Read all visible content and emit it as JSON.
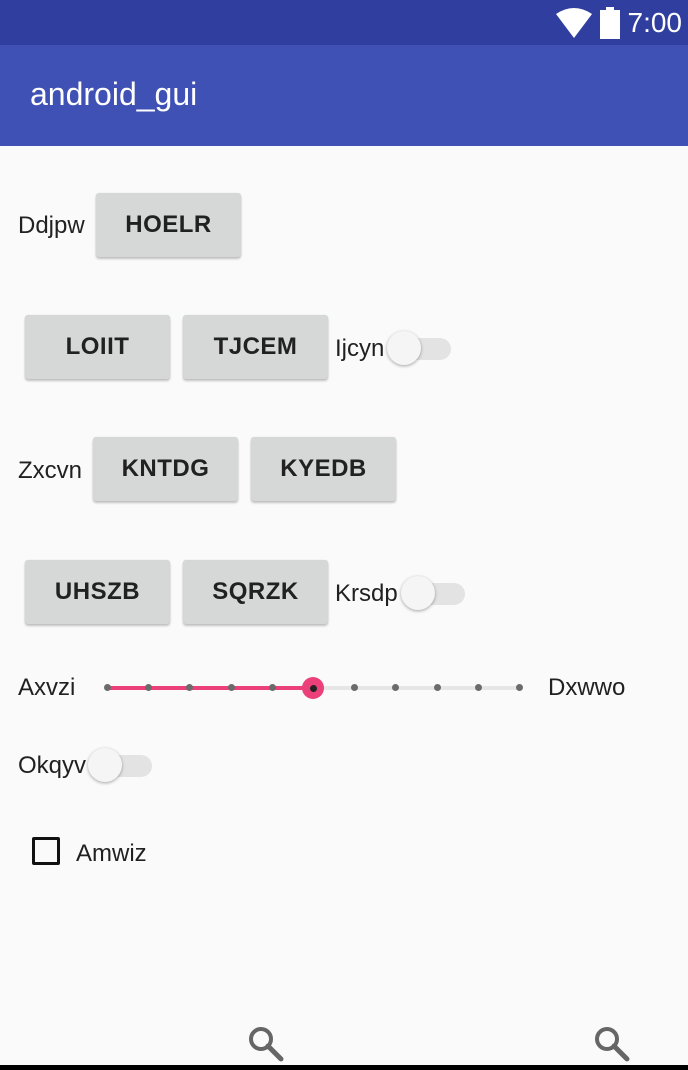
{
  "status_bar": {
    "time": "7:00",
    "icons": [
      "wifi-icon",
      "battery-icon"
    ],
    "color": "#303f9f"
  },
  "app_bar": {
    "title": "android_gui",
    "color": "#3f51b5"
  },
  "rows": {
    "row1": {
      "label": "Ddjpw",
      "button": "HOELR"
    },
    "row2": {
      "buttons": [
        "LOIIT",
        "TJCEM"
      ],
      "switch_label": "Ijcyn",
      "switch_on": false
    },
    "row3": {
      "label": "Zxcvn",
      "buttons": [
        "KNTDG",
        "KYEDB"
      ]
    },
    "row4": {
      "buttons": [
        "UHSZB",
        "SQRZK"
      ],
      "switch_label": "Krsdp",
      "switch_on": false
    },
    "slider": {
      "min_label": "Axvzi",
      "max_label": "Dxwwo",
      "steps": 10,
      "value": 5,
      "accent": "#ec407a"
    },
    "row6": {
      "switch_label": "Okqyv",
      "switch_on": false
    },
    "row7": {
      "checkbox_label": "Amwiz",
      "checked": false
    }
  },
  "bottom_icons": [
    "search-icon",
    "search-icon"
  ]
}
